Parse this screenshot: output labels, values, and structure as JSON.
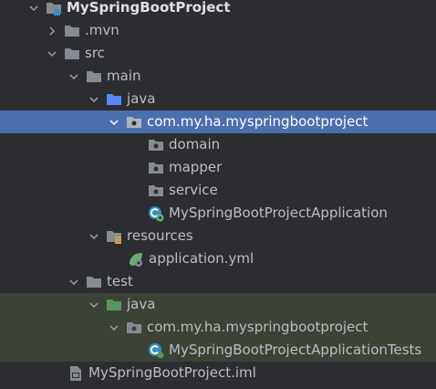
{
  "project_tree": {
    "root": {
      "label": "MySpringBootProject"
    },
    "mvn": {
      "label": ".mvn"
    },
    "src": {
      "label": "src"
    },
    "main": {
      "label": "main"
    },
    "main_java": {
      "label": "java"
    },
    "main_package": {
      "label": "com.my.ha.myspringbootproject"
    },
    "domain": {
      "label": "domain"
    },
    "mapper": {
      "label": "mapper"
    },
    "service": {
      "label": "service"
    },
    "app_class": {
      "label": "MySpringBootProjectApplication"
    },
    "resources": {
      "label": "resources"
    },
    "application_yml": {
      "label": "application.yml"
    },
    "test": {
      "label": "test"
    },
    "test_java": {
      "label": "java"
    },
    "test_package": {
      "label": "com.my.ha.myspringbootproject"
    },
    "test_class": {
      "label": "MySpringBootProjectApplicationTests"
    },
    "iml_file": {
      "label": "MySpringBootProject.iml"
    }
  },
  "colors": {
    "background": "#2b2d30",
    "selection": "#4b6eaf",
    "test_highlight": "#3b4337",
    "folder_gray": "#868a91",
    "source_folder_blue": "#548af7",
    "test_folder_green": "#57965c",
    "spring_green": "#6aab73"
  }
}
